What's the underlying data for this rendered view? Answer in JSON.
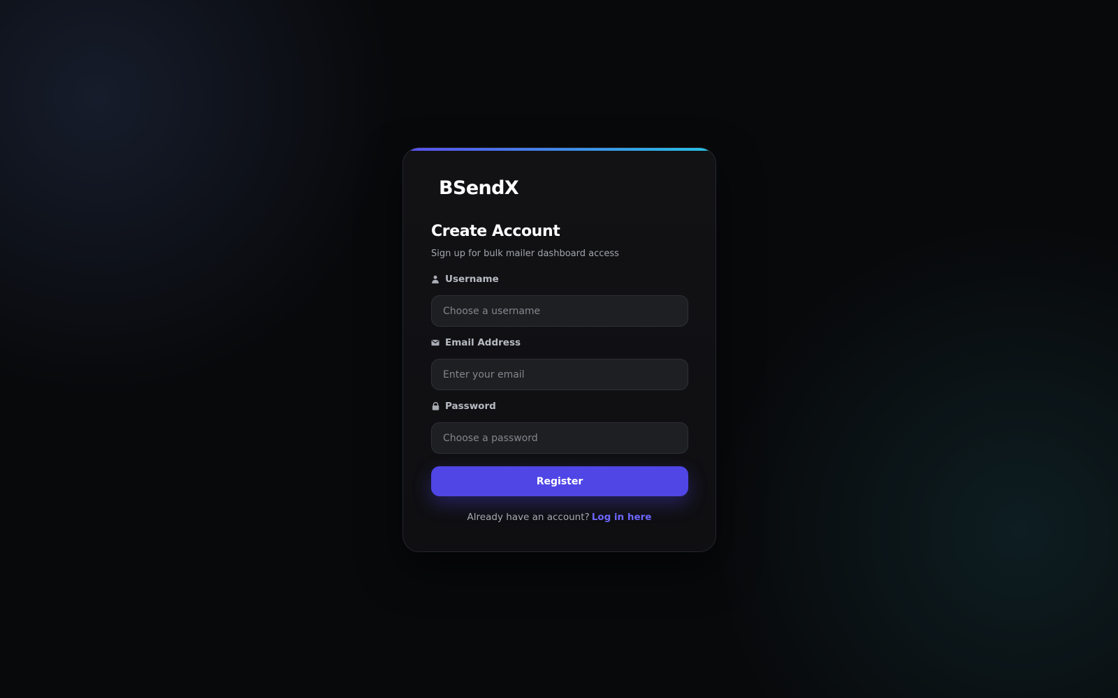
{
  "brand": {
    "name": "BSendX"
  },
  "form": {
    "title": "Create Account",
    "subtitle": "Sign up for bulk mailer dashboard access",
    "fields": {
      "username": {
        "label": "Username",
        "placeholder": "Choose a username",
        "icon": "user-icon"
      },
      "email": {
        "label": "Email Address",
        "placeholder": "Enter your email",
        "icon": "envelope-icon"
      },
      "password": {
        "label": "Password",
        "placeholder": "Choose a password",
        "icon": "lock-icon"
      }
    },
    "submit_label": "Register"
  },
  "footer": {
    "prompt": "Already have an account?",
    "link_label": "Log in here"
  },
  "colors": {
    "accent": "#4f46e5",
    "gradient_start": "#5b4ef0",
    "gradient_end": "#25c4e6",
    "link": "#6d66ff"
  }
}
